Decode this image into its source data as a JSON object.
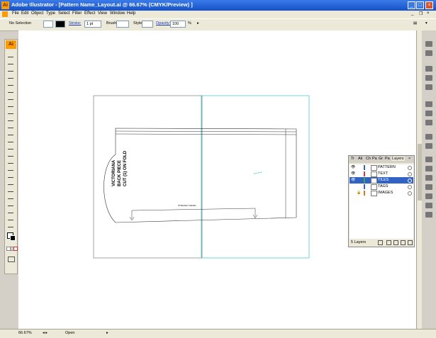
{
  "window": {
    "title": "Adobe Illustrator - [Pattern Name_Layout.ai @ 66.67% (CMYK/Preview) ]"
  },
  "menu": [
    "File",
    "Edit",
    "Object",
    "Type",
    "Select",
    "Filter",
    "Effect",
    "View",
    "Window",
    "Help"
  ],
  "control": {
    "selection": "No Selection",
    "stroke_label": "Stroke:",
    "stroke_value": "1 pt",
    "brush_label": "Brush:",
    "style_label": "Style:",
    "opacity_label": "Opacity:",
    "opacity_value": "100",
    "opacity_unit": "%"
  },
  "artwork": {
    "line1": "VICTORIANA",
    "line2": "BACK PIECE",
    "line3": "CUT",
    "count": "1",
    "line4": "ON FOLD",
    "grain": "STRAIGHT GRAIN"
  },
  "layers_panel": {
    "tabs": [
      "Tr",
      "Ali",
      "Ch",
      "Pa",
      "Gr",
      "Pa",
      "Layers"
    ],
    "layers": [
      {
        "name": "PATTERN",
        "color": "#3a5fd6",
        "visible": true
      },
      {
        "name": "TEXT",
        "color": "#d23b3b",
        "visible": true
      },
      {
        "name": "TILES",
        "color": "#3ab03a",
        "visible": true,
        "selected": true
      },
      {
        "name": "TAGS",
        "color": "#3a5fd6",
        "visible": false
      },
      {
        "name": "IMAGES",
        "color": "#d07a2a",
        "visible": false
      }
    ],
    "count_label": "5 Layers"
  },
  "status": {
    "zoom": "66.67%",
    "state": "Open"
  }
}
